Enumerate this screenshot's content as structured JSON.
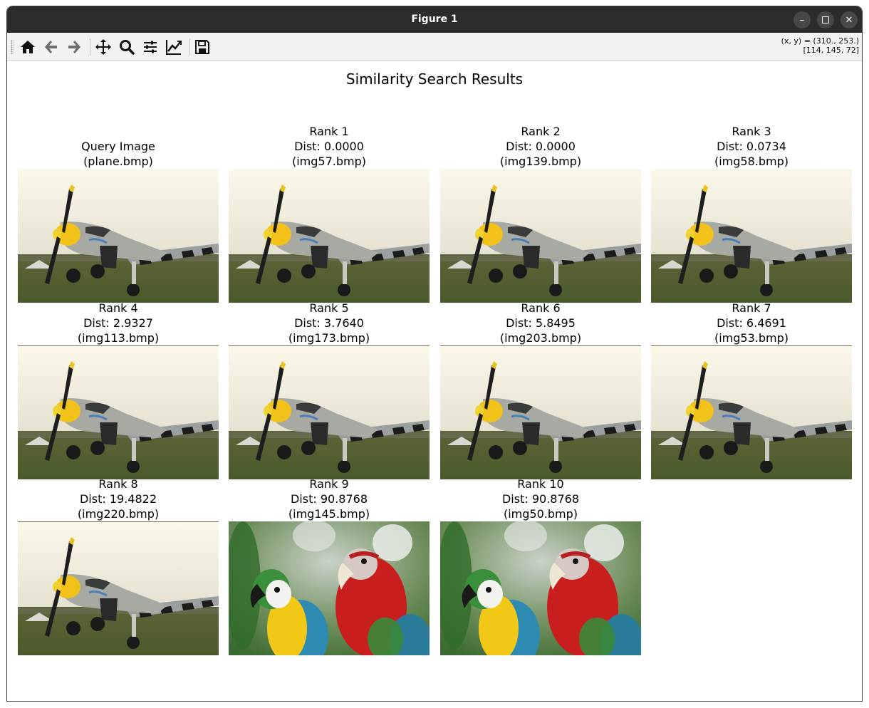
{
  "window": {
    "title": "Figure 1",
    "controls": [
      "minimize-icon",
      "maximize-icon",
      "close-icon"
    ]
  },
  "toolbar": {
    "tools": [
      {
        "name": "home-icon",
        "label": "Home"
      },
      {
        "name": "back-icon",
        "label": "Back"
      },
      {
        "name": "forward-icon",
        "label": "Forward"
      },
      {
        "name": "pan-icon",
        "label": "Pan"
      },
      {
        "name": "zoom-icon",
        "label": "Zoom"
      },
      {
        "name": "configure-subplots-icon",
        "label": "Subplots"
      },
      {
        "name": "edit-axis-icon",
        "label": "Customize"
      },
      {
        "name": "save-icon",
        "label": "Save"
      }
    ],
    "coords_line1": "(x, y) = (310., 253.)",
    "coords_line2": "[114, 145, 72]"
  },
  "figure": {
    "title": "Similarity Search Results",
    "panels": [
      {
        "caption": "Query Image\n(plane.bmp)",
        "image": "plane"
      },
      {
        "caption": "Rank 1\nDist: 0.0000\n(img57.bmp)",
        "image": "plane"
      },
      {
        "caption": "Rank 2\nDist: 0.0000\n(img139.bmp)",
        "image": "plane"
      },
      {
        "caption": "Rank 3\nDist: 0.0734\n(img58.bmp)",
        "image": "plane"
      },
      {
        "caption": "Rank 4\nDist: 2.9327\n(img113.bmp)",
        "image": "plane"
      },
      {
        "caption": "Rank 5\nDist: 3.7640\n(img173.bmp)",
        "image": "plane"
      },
      {
        "caption": "Rank 6\nDist: 5.8495\n(img203.bmp)",
        "image": "plane"
      },
      {
        "caption": "Rank 7\nDist: 6.4691\n(img53.bmp)",
        "image": "plane"
      },
      {
        "caption": "Rank 8\nDist: 19.4822\n(img220.bmp)",
        "image": "plane"
      },
      {
        "caption": "Rank 9\nDist: 90.8768\n(img145.bmp)",
        "image": "parrots"
      },
      {
        "caption": "Rank 10\nDist: 90.8768\n(img50.bmp)",
        "image": "parrots"
      }
    ]
  }
}
